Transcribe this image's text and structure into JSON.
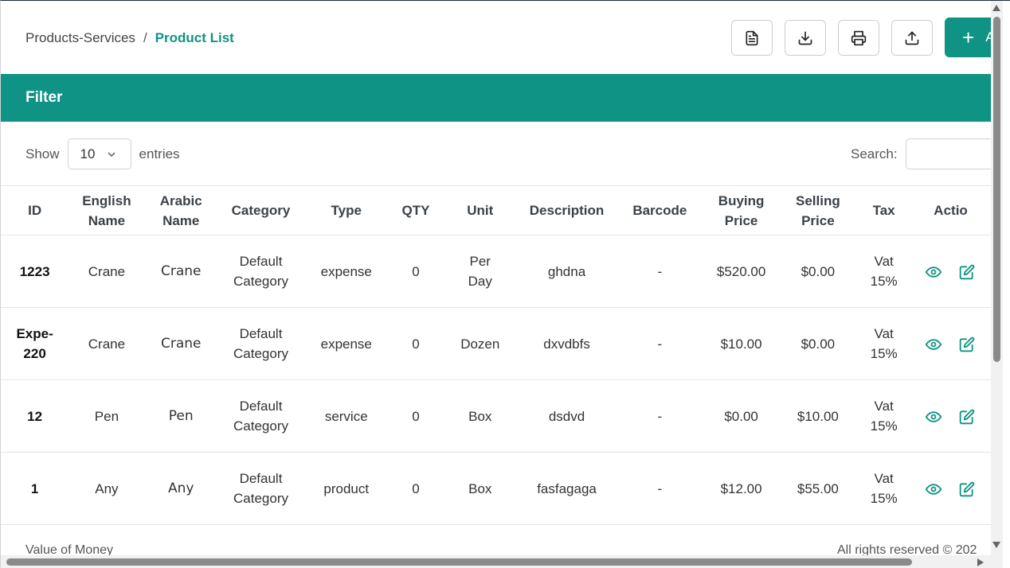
{
  "breadcrumb": {
    "parent": "Products-Services",
    "separator": "/",
    "current": "Product List"
  },
  "toolbar": {
    "buttons": [
      {
        "icon": "document-icon"
      },
      {
        "icon": "download-icon"
      },
      {
        "icon": "print-icon"
      },
      {
        "icon": "upload-icon"
      }
    ],
    "add_label": "A"
  },
  "filter": {
    "title": "Filter"
  },
  "length": {
    "show_label": "Show",
    "value": "10",
    "entries_label": "entries"
  },
  "search": {
    "label": "Search:",
    "value": ""
  },
  "table": {
    "headers": {
      "id": "ID",
      "english_name": [
        "English",
        "Name"
      ],
      "arabic_name": [
        "Arabic",
        "Name"
      ],
      "category": "Category",
      "type": "Type",
      "qty": "QTY",
      "unit": "Unit",
      "description": "Description",
      "barcode": "Barcode",
      "buying_price": [
        "Buying",
        "Price"
      ],
      "selling_price": [
        "Selling",
        "Price"
      ],
      "tax": "Tax",
      "actions": "Actio"
    },
    "rows": [
      {
        "id": [
          "1223"
        ],
        "english_name": "Crane",
        "arabic_name": "Crane",
        "category": [
          "Default",
          "Category"
        ],
        "type": "expense",
        "qty": "0",
        "unit": [
          "Per",
          "Day"
        ],
        "description": "ghdna",
        "barcode": "-",
        "buying_price": "$520.00",
        "selling_price": "$0.00",
        "tax": [
          "Vat",
          "15%"
        ]
      },
      {
        "id": [
          "Expe-",
          "220"
        ],
        "english_name": "Crane",
        "arabic_name": "Crane",
        "category": [
          "Default",
          "Category"
        ],
        "type": "expense",
        "qty": "0",
        "unit": [
          "Dozen"
        ],
        "description": "dxvdbfs",
        "barcode": "-",
        "buying_price": "$10.00",
        "selling_price": "$0.00",
        "tax": [
          "Vat",
          "15%"
        ]
      },
      {
        "id": [
          "12"
        ],
        "english_name": "Pen",
        "arabic_name": "Pen",
        "category": [
          "Default",
          "Category"
        ],
        "type": "service",
        "qty": "0",
        "unit": [
          "Box"
        ],
        "description": "dsdvd",
        "barcode": "-",
        "buying_price": "$0.00",
        "selling_price": "$10.00",
        "tax": [
          "Vat",
          "15%"
        ]
      },
      {
        "id": [
          "1"
        ],
        "english_name": "Any",
        "arabic_name": "Any",
        "category": [
          "Default",
          "Category"
        ],
        "type": "product",
        "qty": "0",
        "unit": [
          "Box"
        ],
        "description": "fasfagaga",
        "barcode": "-",
        "buying_price": "$12.00",
        "selling_price": "$55.00",
        "tax": [
          "Vat",
          "15%"
        ]
      }
    ]
  },
  "footer": {
    "left": "Value of Money",
    "right": "All rights reserved © 202"
  },
  "colors": {
    "accent": "#0e9384",
    "text": "#333a40",
    "border": "#e3e6e9"
  }
}
